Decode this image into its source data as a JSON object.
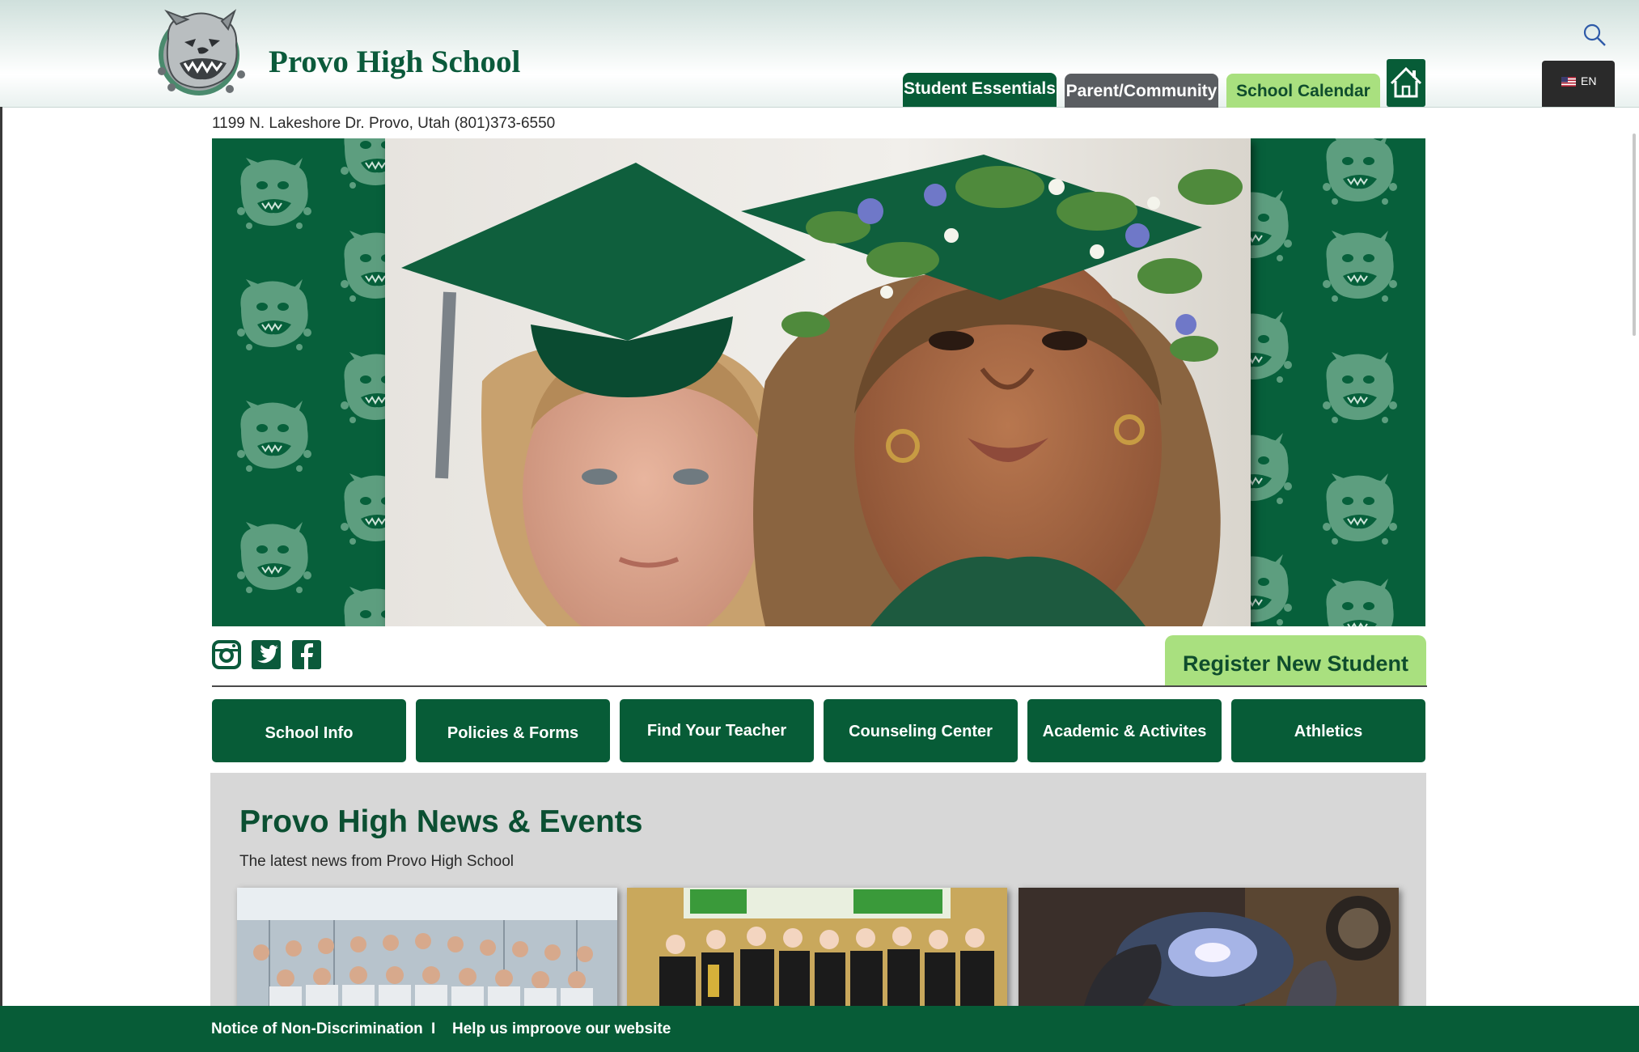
{
  "header": {
    "school_name": "Provo High School",
    "nav": [
      {
        "label": "Student Essentials"
      },
      {
        "label": "Parent/Community"
      },
      {
        "label": "School Calendar"
      }
    ],
    "language": "EN"
  },
  "address": "1199 N. Lakeshore Dr. Provo, Utah (801)373-6550",
  "register_button": "Register New Student",
  "quick_links": [
    {
      "label": "School Info"
    },
    {
      "label": "Policies & Forms"
    },
    {
      "label": "Find Your Teacher"
    },
    {
      "label": "Counseling Center"
    },
    {
      "label": "Academic & Activites"
    },
    {
      "label": "Athletics"
    }
  ],
  "news": {
    "title": "Provo High News & Events",
    "subtitle": "The latest news from Provo High School"
  },
  "footer": {
    "links": [
      {
        "label": "Notice of Non-Discrimination"
      },
      {
        "label": "Help us improove our website"
      }
    ],
    "separator": "I"
  },
  "colors": {
    "primary_green": "#075c37",
    "light_green": "#a9e07f",
    "gray_tab": "#5a5d61",
    "news_bg": "#d7d7d7"
  }
}
